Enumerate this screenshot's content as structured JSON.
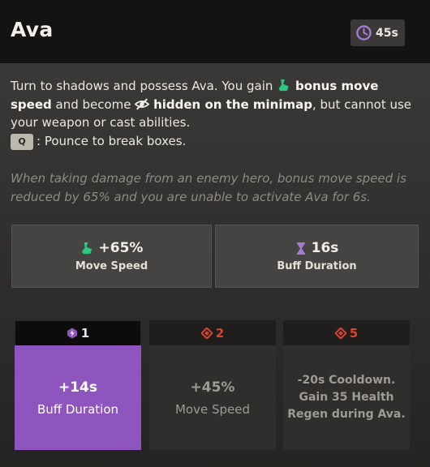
{
  "header": {
    "title": "Ava",
    "cooldown": "45s",
    "cooldown_icon": "cooldown-clock-icon"
  },
  "description": {
    "part1": "Turn to shadows and possess Ava. You gain ",
    "bold1": "bonus move speed",
    "part2": " and become ",
    "bold2": "hidden on the minimap",
    "part3": ", but cannot use your weapon or cast abilities.",
    "key": "Q",
    "key_text": ": Pounce to break boxes."
  },
  "note": "When taking damage from an enemy hero, bonus move speed is reduced by 65% and you are unable to activate Ava for 6s.",
  "stats": [
    {
      "value": "+65%",
      "label": "Move Speed",
      "icon": "boot-icon"
    },
    {
      "value": "16s",
      "label": "Buff Duration",
      "icon": "hourglass-icon"
    }
  ],
  "tiers": [
    {
      "number": "1",
      "icon": "spirit-bolt-icon",
      "value": "+14s",
      "label": "Buff Duration",
      "active": true
    },
    {
      "number": "2",
      "icon": "diamond-icon",
      "value": "+45%",
      "label": "Move Speed",
      "active": false
    },
    {
      "number": "5",
      "icon": "diamond-icon",
      "line1": "-20s Cooldown.",
      "line2": "Gain 35 Health",
      "line3": "Regen during Ava.",
      "active": false
    }
  ],
  "colors": {
    "accent_purple": "#8d55bd",
    "move_speed_green": "#2fc77f",
    "tier_red": "#d8442d"
  }
}
